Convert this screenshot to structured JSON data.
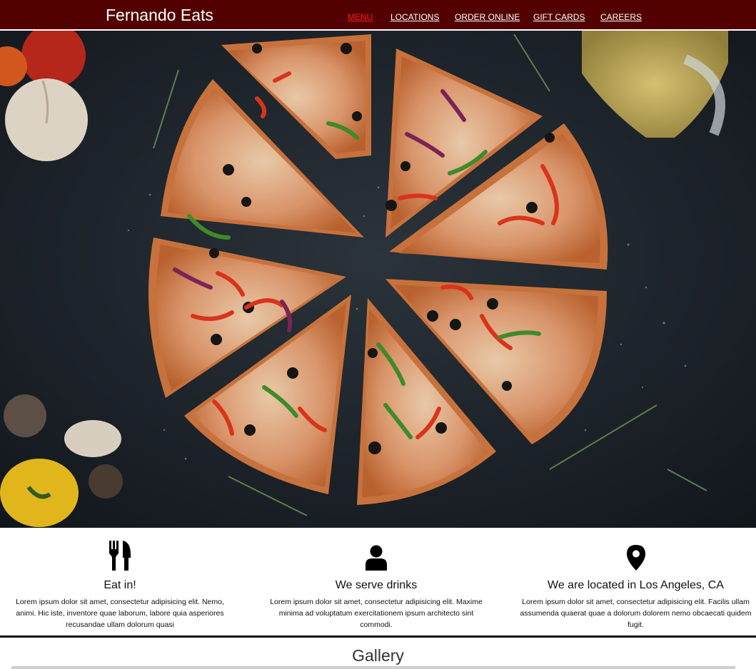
{
  "header": {
    "brand": "Fernando Eats",
    "nav": [
      {
        "label": "MENU",
        "active": true
      },
      {
        "label": "LOCATIONS"
      },
      {
        "label": "ORDER ONLINE"
      },
      {
        "label": "GIFT CARDS"
      },
      {
        "label": "CAREERS"
      }
    ]
  },
  "colors": {
    "header_bg": "#520000",
    "active_link": "#ff1a1a"
  },
  "hero": {
    "image": "pizza-photo"
  },
  "features": [
    {
      "icon": "utensils-icon",
      "title": "Eat in!",
      "text": "Lorem ipsum dolor sit amet, consectetur adipisicing elit. Nemo, animi. Hic iste, inventore quae laborum, labore quia asperiores recusandae ullam dolorum quasi"
    },
    {
      "icon": "user-icon",
      "title": "We serve drinks",
      "text": "Lorem ipsum dolor sit amet, consectetur adipisicing elit. Maxime minima ad voluptatum exercitationem ipsum architecto sint commodi."
    },
    {
      "icon": "map-marker-icon",
      "title": "We are located in Los Angeles, CA",
      "text": "Lorem ipsum dolor sit amet, consectetur adipisicing elit. Facilis ullam assumenda quaerat quae a dolorum dolorem nemo obcaecati quidem fugit."
    }
  ],
  "gallery": {
    "title": "Gallery"
  }
}
